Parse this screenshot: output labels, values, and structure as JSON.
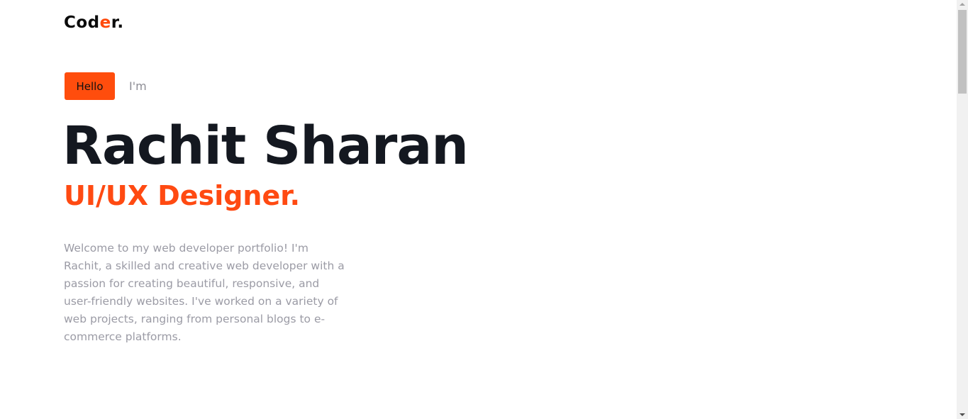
{
  "header": {
    "logo_part1": "Cod",
    "logo_accent": "e",
    "logo_part2": "r."
  },
  "hero": {
    "hello_label": "Hello",
    "intro_text": "I'm",
    "name": "Rachit Sharan",
    "role": "UI/UX Designer.",
    "bio": "Welcome to my web developer portfolio! I'm Rachit, a skilled and creative web developer with a passion for creating beautiful, responsive, and user-friendly websites. I've worked on a variety of web projects, ranging from personal blogs to e-commerce platforms."
  },
  "colors": {
    "accent": "#ff4d0d",
    "heading": "#141820",
    "muted": "#9b9ba5"
  }
}
